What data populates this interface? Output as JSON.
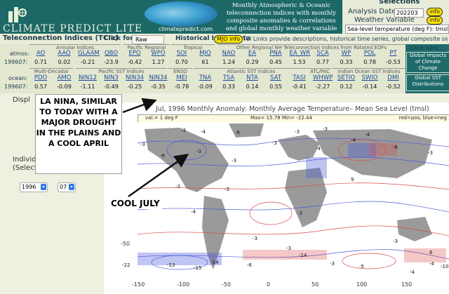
{
  "header": {
    "logo_text": "CLIMATE PREDICT LITE",
    "globe_url": "climatepredict.com",
    "description": "Monthly Atmospheric & Oceanic teleconnection indices with monthly composite anomalies & correlations and global monthly weather variable anomalies"
  },
  "selections": {
    "title": "Selections",
    "analysis_date_label": "Analysis Date",
    "analysis_date_value": "202203",
    "weather_variable_label": "Weather Variable",
    "weather_variable_value": "Sea-level temperature (deg F): tmsl",
    "info_label": "info"
  },
  "nav": {
    "title": "Teleconnection Indices (TCIs)",
    "click_for": "Click for",
    "raw_button": "Raw",
    "historical": "Historical Index Data",
    "mjo_info": "MJO info",
    "links_text": "TCI Links provide descriptions, historical time series, global composite signatures, etc."
  },
  "atmos": {
    "row_label": "atmos:",
    "date": "199607:",
    "groups": [
      "Annular Indices",
      "Pacific Regional",
      "Tropical",
      "Other Regional NH Teleconnection Indices from Rotated EOFs"
    ],
    "indices": [
      "AO",
      "AAO",
      "GLAAM",
      "QBO",
      "EPO",
      "WPO",
      "SOI",
      "MJO",
      "NAO",
      "EA",
      "PNA",
      "EA_WR",
      "SCA",
      "WP",
      "POL",
      "PT"
    ],
    "values": [
      "0.71",
      "0.02",
      "-0.21",
      "-23.9",
      "-0.42",
      "1.27",
      "0.70",
      "61",
      "1.24",
      "0.29",
      "0.45",
      "1.53",
      "0.77",
      "0.33",
      "0.78",
      "-0.53"
    ]
  },
  "ocean": {
    "row_label": "ocean:",
    "date": "199607:",
    "groups": [
      "Multi-Decadal",
      "Pacific SST Indices",
      "ENSO",
      "Atlantic SST Indices",
      "ATL/PAC",
      "Indian Ocean SST Indices"
    ],
    "indices": [
      "PDO",
      "AMO",
      "NIN12",
      "NIN3",
      "NIN34",
      "NIN34",
      "MEI",
      "TNA",
      "TSA",
      "NTA",
      "SAT",
      "TASI",
      "WHWP",
      "SETIO",
      "SWIO",
      "DMI"
    ],
    "values": [
      "0.57",
      "-0.09",
      "-1.11",
      "-0.49",
      "-0.25",
      "-0.35",
      "-0.78",
      "-0.09",
      "0.33",
      "0.14",
      "0.55",
      "-0.41",
      "-2.27",
      "0.12",
      "-0.14",
      "-0.52"
    ]
  },
  "side_buttons": {
    "click_here": "Click here for:",
    "global_impacts": "Global Impacts of Climate Change",
    "global_sst": "Global SST Distributions"
  },
  "left_panel": {
    "display_label": "Displ",
    "individual_label": "Individ",
    "select_label": "(Select",
    "year_value": "1996",
    "month_value": "07"
  },
  "map": {
    "title": "Jul, 1996   Monthly Anomaly: Monthly Average Temperature– Mean Sea Level (tmsl)",
    "interval": "val.= 1 deg F",
    "maxmin": "Max= 15.78  Min= -22.44",
    "legend": "red=pos; blue=neg",
    "contour_labels": [
      "-3",
      "-4",
      "-6",
      "-3",
      "-3",
      "-4",
      "-3",
      "-3",
      "-6",
      "-3",
      "-3",
      "-4",
      "-4",
      "-6",
      "-3",
      "-3",
      "-3",
      "-4",
      "-3",
      "-3",
      "-3",
      "-22",
      "-15",
      "-13",
      "-14",
      "-3",
      "-5",
      "-4",
      "-4",
      "-10",
      "-6",
      "-14",
      "-3",
      "6",
      "9"
    ],
    "x_ticks": [
      "-150",
      "-100",
      "-50",
      "0",
      "50",
      "100",
      "150"
    ],
    "y_ticks": [
      "-50"
    ]
  },
  "annotations": {
    "main": "LA NINA, SIMILAR TO TODAY WITH A MAJOR DROUGHT IN THE PLAINS AND A COOL APRIL",
    "cool_july": "COOL JULY"
  },
  "colors": {
    "header_bg": "#1c6867",
    "panel_bg": "#e3e7d0",
    "link_blue": "#1a4a9a",
    "pos_red": "#d94a4a",
    "neg_blue": "#4a5ad9"
  }
}
